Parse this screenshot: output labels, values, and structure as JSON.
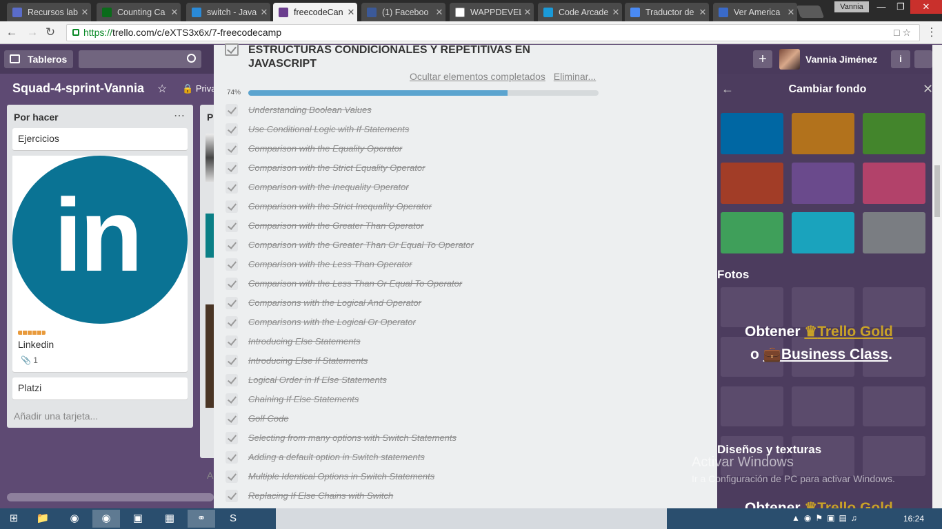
{
  "browser": {
    "tabs": [
      {
        "title": "Recursos lab",
        "icon": "code-icon",
        "color": "#5a6cc9"
      },
      {
        "title": "Counting Ca",
        "icon": "freecodecamp-icon",
        "color": "#0a6b1a"
      },
      {
        "title": "switch - Java",
        "icon": "chat-icon",
        "color": "#2a8ad8"
      },
      {
        "title": "freecodeCan",
        "icon": "trello-icon",
        "color": "#6b3e8e"
      },
      {
        "title": "(1) Faceboo",
        "icon": "facebook-icon",
        "color": "#3b5998"
      },
      {
        "title": "WAPPDEVEL",
        "icon": "document-icon",
        "color": "#ffffff"
      },
      {
        "title": "Code Arcade",
        "icon": "code-arcade-icon",
        "color": "#1a9ad8"
      },
      {
        "title": "Traductor de",
        "icon": "translate-icon",
        "color": "#4a8af4"
      },
      {
        "title": "Ver America",
        "icon": "globe-icon",
        "color": "#3a6ac8"
      }
    ],
    "profile_name": "Vannia",
    "url_scheme": "https://",
    "url_rest": "trello.com/c/eXTS3x6x/7-freecodecamp"
  },
  "trello": {
    "boards_label": "Tableros",
    "user_name": "Vannia Jiménez",
    "board_name": "Squad-4-sprint-Vannia",
    "privacy": "Priva",
    "list1": {
      "title": "Por hacer",
      "cards": [
        "Ejercicios",
        "Linkedin",
        "Platzi"
      ],
      "attachment_count": "1",
      "add_card": "Añadir una tarjeta..."
    },
    "list2": {
      "title": "P",
      "add": "A"
    }
  },
  "checklist": {
    "title": "ESTRUCTURAS CONDICIONALES Y REPETITIVAS EN JAVASCRIPT",
    "hide_completed": "Ocultar elementos completados",
    "delete": "Eliminar...",
    "percent_label": "74%",
    "progress": 0.74,
    "items": [
      "Understanding Boolean Values",
      "Use Conditional Logic with If Statements",
      "Comparison with the Equality Operator",
      "Comparison with the Strict Equality Operator",
      "Comparison with the Inequality Operator",
      "Comparison with the Strict Inequality Operator",
      "Comparison with the Greater Than Operator",
      "Comparison with the Greater Than Or Equal To Operator",
      "Comparison with the Less Than Operator",
      "Comparison with the Less Than Or Equal To Operator",
      "Comparisons with the Logical And Operator",
      "Comparisons with the Logical Or Operator",
      "Introducing Else Statements",
      "Introducing Else If Statements",
      "Logical Order in If Else Statements",
      "Chaining If Else Statements",
      "Golf Code",
      "Selecting from many options with Switch Statements",
      "Adding a default option in Switch statements",
      "Multiple Identical Options in Switch Statements",
      "Replacing If Else Chains with Switch"
    ]
  },
  "panel": {
    "title": "Cambiar fondo",
    "colors": [
      "#0067a3",
      "#b2721c",
      "#43852c",
      "#a23d27",
      "#6a4a8c",
      "#b2426a",
      "#3f9f5a",
      "#1aa3bd",
      "#7a7d82"
    ],
    "photos_label": "Fotos",
    "gold_obtain": "Obtener",
    "gold_link": "Trello Gold",
    "or": "o",
    "business_link": "Business Class",
    "period": ".",
    "textures_label": "Diseños y texturas"
  },
  "windows": {
    "activate_title": "Activar Windows",
    "activate_sub": "Ir a Configuración de PC para activar Windows.",
    "clock": "16:24"
  }
}
